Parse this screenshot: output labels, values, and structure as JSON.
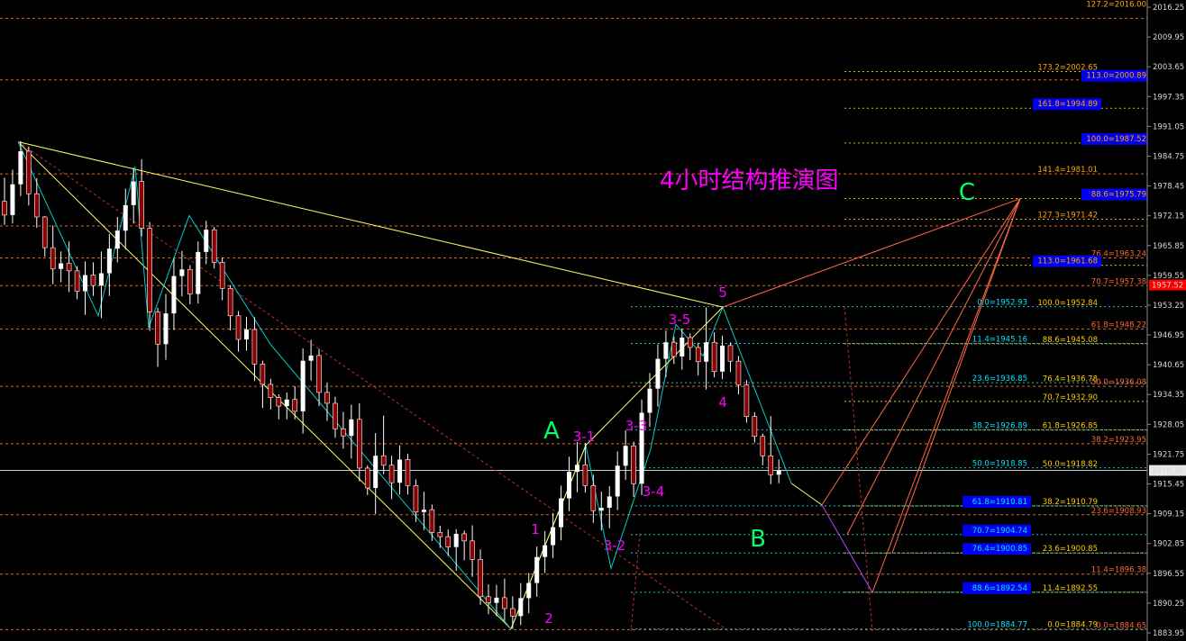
{
  "chart_data": {
    "type": "candlestick",
    "title": "4小时结构推演图",
    "ylim": [
      1883.95,
      2016.25
    ],
    "y_ticks": [
      "2016.25",
      "2009.95",
      "2003.65",
      "1997.35",
      "1991.05",
      "1984.75",
      "1978.45",
      "1972.15",
      "1965.85",
      "1959.55",
      "1953.25",
      "1946.95",
      "1940.65",
      "1934.35",
      "1928.05",
      "1921.75",
      "1915.45",
      "1909.15",
      "1902.85",
      "1896.55",
      "1890.25",
      "1883.95"
    ],
    "current_price": "1918.30",
    "alert_price": "1957.52",
    "candles_ohlc": [
      [
        1975.2,
        1980.2,
        1970.2,
        1972.3
      ],
      [
        1972.3,
        1981.9,
        1970.5,
        1978.8
      ],
      [
        1978.8,
        1987.9,
        1976.3,
        1985.8
      ],
      [
        1985.8,
        1986.8,
        1974.3,
        1976.8
      ],
      [
        1976.8,
        1980.1,
        1969.6,
        1971.9
      ],
      [
        1971.9,
        1972.1,
        1963.5,
        1965.4
      ],
      [
        1965.4,
        1970.1,
        1957.7,
        1960.9
      ],
      [
        1960.9,
        1964.6,
        1958.1,
        1962.1
      ],
      [
        1962.1,
        1966.7,
        1956.0,
        1960.5
      ],
      [
        1960.5,
        1961.5,
        1954.5,
        1956.2
      ],
      [
        1956.2,
        1962.5,
        1951.2,
        1959.6
      ],
      [
        1959.6,
        1962.3,
        1955.2,
        1957.4
      ],
      [
        1957.4,
        1964.6,
        1950.5,
        1960.0
      ],
      [
        1960.0,
        1968.3,
        1955.2,
        1965.2
      ],
      [
        1965.2,
        1971.9,
        1962.3,
        1969.0
      ],
      [
        1969.0,
        1977.9,
        1965.0,
        1974.4
      ],
      [
        1974.4,
        1982.3,
        1970.5,
        1979.4
      ],
      [
        1979.4,
        1984.1,
        1967.8,
        1969.5
      ],
      [
        1969.5,
        1970.8,
        1947.8,
        1951.8
      ],
      [
        1951.8,
        1952.7,
        1940.2,
        1945.0
      ],
      [
        1945.0,
        1955.6,
        1941.7,
        1951.5
      ],
      [
        1951.5,
        1963.1,
        1948.0,
        1959.4
      ],
      [
        1959.4,
        1964.7,
        1955.1,
        1960.8
      ],
      [
        1960.8,
        1961.7,
        1953.4,
        1955.6
      ],
      [
        1955.6,
        1966.7,
        1953.6,
        1964.5
      ],
      [
        1964.5,
        1971.1,
        1961.9,
        1969.2
      ],
      [
        1969.2,
        1969.8,
        1961.0,
        1962.3
      ],
      [
        1962.3,
        1963.3,
        1954.3,
        1956.8
      ],
      [
        1956.8,
        1957.5,
        1947.9,
        1951.0
      ],
      [
        1951.0,
        1952.0,
        1943.4,
        1946.0
      ],
      [
        1946.0,
        1950.8,
        1943.6,
        1948.1
      ],
      [
        1948.1,
        1950.7,
        1937.2,
        1940.8
      ],
      [
        1940.8,
        1941.5,
        1931.5,
        1936.5
      ],
      [
        1936.5,
        1937.7,
        1931.2,
        1933.7
      ],
      [
        1933.7,
        1934.4,
        1929.1,
        1931.9
      ],
      [
        1931.9,
        1934.8,
        1929.1,
        1933.3
      ],
      [
        1933.3,
        1936.1,
        1929.1,
        1930.8
      ],
      [
        1930.8,
        1944.1,
        1926.1,
        1941.5
      ],
      [
        1941.5,
        1945.9,
        1937.3,
        1942.6
      ],
      [
        1942.6,
        1944.0,
        1931.9,
        1934.8
      ],
      [
        1934.8,
        1936.9,
        1928.8,
        1932.5
      ],
      [
        1932.5,
        1933.9,
        1925.2,
        1927.1
      ],
      [
        1927.1,
        1930.7,
        1922.9,
        1925.6
      ],
      [
        1925.6,
        1932.2,
        1920.8,
        1929.1
      ],
      [
        1929.1,
        1932.5,
        1916.0,
        1918.8
      ],
      [
        1918.8,
        1919.4,
        1913.1,
        1914.6
      ],
      [
        1914.6,
        1926.2,
        1909.1,
        1921.4
      ],
      [
        1921.4,
        1929.9,
        1917.5,
        1919.4
      ],
      [
        1919.4,
        1921.4,
        1912.2,
        1915.7
      ],
      [
        1915.7,
        1923.6,
        1913.2,
        1920.6
      ],
      [
        1920.6,
        1921.8,
        1913.2,
        1915.1
      ],
      [
        1915.1,
        1916.4,
        1907.4,
        1909.5
      ],
      [
        1909.5,
        1913.8,
        1905.7,
        1910.0
      ],
      [
        1910.0,
        1911.1,
        1903.4,
        1905.2
      ],
      [
        1905.2,
        1906.6,
        1901.9,
        1904.3
      ],
      [
        1904.3,
        1905.8,
        1900.2,
        1902.1
      ],
      [
        1902.1,
        1905.9,
        1897.1,
        1904.9
      ],
      [
        1904.9,
        1905.6,
        1899.3,
        1903.4
      ],
      [
        1903.4,
        1906.7,
        1895.8,
        1899.5
      ],
      [
        1899.5,
        1901.6,
        1889.9,
        1891.6
      ],
      [
        1891.6,
        1894.2,
        1887.9,
        1890.3
      ],
      [
        1890.3,
        1894.1,
        1887.5,
        1891.4
      ],
      [
        1891.4,
        1895.4,
        1886.5,
        1889.1
      ],
      [
        1889.1,
        1891.7,
        1884.8,
        1887.5
      ],
      [
        1887.5,
        1894.5,
        1885.6,
        1891.3
      ],
      [
        1891.3,
        1896.6,
        1888.1,
        1894.5
      ],
      [
        1894.5,
        1902.2,
        1891.6,
        1900.0
      ],
      [
        1900.0,
        1905.5,
        1896.6,
        1902.5
      ],
      [
        1902.5,
        1909.3,
        1899.8,
        1906.3
      ],
      [
        1906.3,
        1915.1,
        1903.5,
        1912.4
      ],
      [
        1912.4,
        1921.2,
        1909.7,
        1918.0
      ],
      [
        1918.0,
        1924.3,
        1913.7,
        1919.5
      ],
      [
        1919.5,
        1924.1,
        1913.6,
        1915.1
      ],
      [
        1915.1,
        1917.4,
        1907.2,
        1909.8
      ],
      [
        1909.8,
        1913.8,
        1905.6,
        1910.4
      ],
      [
        1910.4,
        1915.0,
        1906.1,
        1912.8
      ],
      [
        1912.8,
        1922.3,
        1909.9,
        1919.3
      ],
      [
        1919.3,
        1926.8,
        1916.3,
        1923.5
      ],
      [
        1923.5,
        1924.4,
        1912.7,
        1915.5
      ],
      [
        1915.5,
        1933.3,
        1913.1,
        1930.5
      ],
      [
        1930.5,
        1938.9,
        1927.5,
        1935.6
      ],
      [
        1935.6,
        1945.0,
        1931.8,
        1941.9
      ],
      [
        1941.9,
        1947.9,
        1938.0,
        1945.4
      ],
      [
        1945.4,
        1946.6,
        1940.8,
        1942.4
      ],
      [
        1942.4,
        1948.3,
        1939.6,
        1946.4
      ],
      [
        1946.4,
        1947.3,
        1941.6,
        1944.3
      ],
      [
        1944.3,
        1945.3,
        1938.4,
        1941.3
      ],
      [
        1941.3,
        1952.8,
        1935.4,
        1945.4
      ],
      [
        1945.4,
        1947.5,
        1938.0,
        1939.2
      ],
      [
        1939.2,
        1946.8,
        1937.6,
        1944.7
      ],
      [
        1944.7,
        1945.4,
        1939.1,
        1941.4
      ],
      [
        1941.4,
        1942.5,
        1934.4,
        1936.4
      ],
      [
        1936.4,
        1937.4,
        1928.4,
        1929.7
      ],
      [
        1929.7,
        1930.6,
        1924.2,
        1925.5
      ],
      [
        1925.5,
        1926.1,
        1919.4,
        1921.4
      ],
      [
        1921.4,
        1929.8,
        1915.4,
        1917.4
      ],
      [
        1917.4,
        1920.6,
        1915.6,
        1918.3
      ]
    ],
    "wave_labels": [
      "A",
      "B",
      "C",
      "1",
      "2",
      "3-1",
      "3-2",
      "3-3",
      "3-4",
      "3-5",
      "4",
      "5"
    ],
    "fib_levels": [
      {
        "text": "127.2=2016.00",
        "color": "#ffa500"
      },
      {
        "text": "173.2=2002.65",
        "color": "#ffa500"
      },
      {
        "text": "113.0=2000.89",
        "color": "#ffa500",
        "box": true
      },
      {
        "text": "161.8=1994.89",
        "color": "#ffa500",
        "box": true
      },
      {
        "text": "100.0=1987.52",
        "color": "#ffa500",
        "box": true
      },
      {
        "text": "141.4=1981.01",
        "color": "#ffa500"
      },
      {
        "text": "88.6=1975.79",
        "color": "#ffa500",
        "box": true
      },
      {
        "text": "127.3=1971.42",
        "color": "#ffa500"
      },
      {
        "text": "76.4=1963.24",
        "color": "#ff6633"
      },
      {
        "text": "113.0=1961.68",
        "color": "#ffa500",
        "box": true
      },
      {
        "text": "70.7=1957.38",
        "color": "#ff6633"
      },
      {
        "text": "0.0=1952.93",
        "color": "#00e5ff"
      },
      {
        "text": "100.0=1952.84",
        "color": "#ffcc00"
      },
      {
        "text": "61.8=1948.22",
        "color": "#ff6633"
      },
      {
        "text": "11.4=1945.16",
        "color": "#00e5ff"
      },
      {
        "text": "88.6=1945.08",
        "color": "#ffcc00"
      },
      {
        "text": "23.6=1936.85",
        "color": "#00e5ff"
      },
      {
        "text": "76.4=1936.78",
        "color": "#ffcc00"
      },
      {
        "text": "50.0=1936.08",
        "color": "#ff6633"
      },
      {
        "text": "70.7=1932.90",
        "color": "#ffcc00"
      },
      {
        "text": "38.2=1926.89",
        "color": "#00e5ff"
      },
      {
        "text": "61.8=1926.85",
        "color": "#ffcc00"
      },
      {
        "text": "38.2=1923.95",
        "color": "#ff6633"
      },
      {
        "text": "50.0=1918.85",
        "color": "#00e5ff"
      },
      {
        "text": "50.0=1918.82",
        "color": "#ffcc00"
      },
      {
        "text": "61.8=1910.81",
        "color": "#00e5ff",
        "box": true
      },
      {
        "text": "38.2=1910.79",
        "color": "#ffcc00"
      },
      {
        "text": "23.6=1908.93",
        "color": "#ff6633"
      },
      {
        "text": "70.7=1904.74",
        "color": "#00e5ff",
        "box": true
      },
      {
        "text": "76.4=1900.85",
        "color": "#00e5ff",
        "box": true
      },
      {
        "text": "23.6=1900.85",
        "color": "#ffcc00"
      },
      {
        "text": "11.4=1896.38",
        "color": "#ff6633"
      },
      {
        "text": "88.6=1892.54",
        "color": "#00e5ff",
        "box": true
      },
      {
        "text": "11.4=1892.55",
        "color": "#ffcc00"
      },
      {
        "text": "100.0=1884.77",
        "color": "#00e5ff"
      },
      {
        "text": "0.0=1884.79",
        "color": "#ffcc00"
      },
      {
        "text": "0.0=1884.65",
        "color": "#ff6633"
      }
    ],
    "colors": {
      "background": "#000000",
      "candle_bull": "#ffffff",
      "candle_bear": "#8b0000",
      "wave_label": "#ff00ff",
      "abc_label": "#00ff66",
      "trendline": "#ffff66",
      "projection": "#ff6644",
      "channel": "#00cccc",
      "alert": "#ff0000",
      "current": "#cccccc"
    }
  }
}
